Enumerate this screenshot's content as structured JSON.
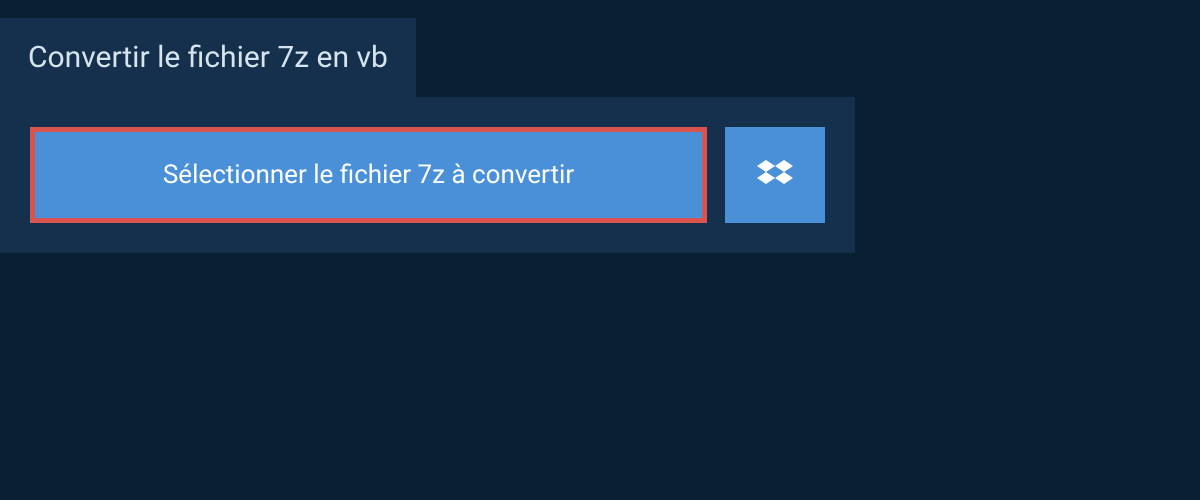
{
  "header": {
    "title": "Convertir le fichier 7z en vb"
  },
  "actions": {
    "select_file_label": "Sélectionner le fichier 7z à convertir"
  }
}
